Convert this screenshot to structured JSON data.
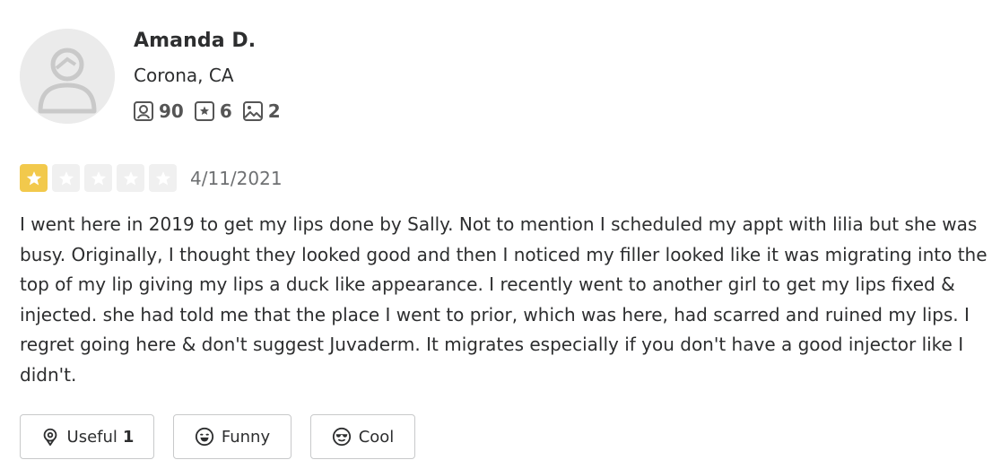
{
  "user": {
    "name": "Amanda D.",
    "location": "Corona, CA",
    "avatar_icon": "default-user-avatar-icon",
    "stats": {
      "friends": "90",
      "reviews": "6",
      "photos": "2"
    }
  },
  "review": {
    "rating": 1,
    "max_rating": 5,
    "date": "4/11/2021",
    "text": "I went here in 2019 to get my lips done by Sally. Not to mention I scheduled my appt with lilia but she was busy. Originally, I thought they looked good and then I noticed my filler looked like it was migrating into the top of my lip giving my lips a duck like appearance. I recently went to another girl to get my lips fixed & injected. she had told me that the place I went to prior, which was here, had scarred and ruined my lips. I regret going here & don't suggest Juvaderm. It migrates especially if you don't have a good injector like I didn't."
  },
  "actions": {
    "useful_label": "Useful",
    "useful_count": "1",
    "funny_label": "Funny",
    "cool_label": "Cool"
  },
  "colors": {
    "star_filled": "#f2c94c",
    "star_empty": "#f0f0f0",
    "text": "#2d2e2f",
    "muted": "#6e7072"
  }
}
